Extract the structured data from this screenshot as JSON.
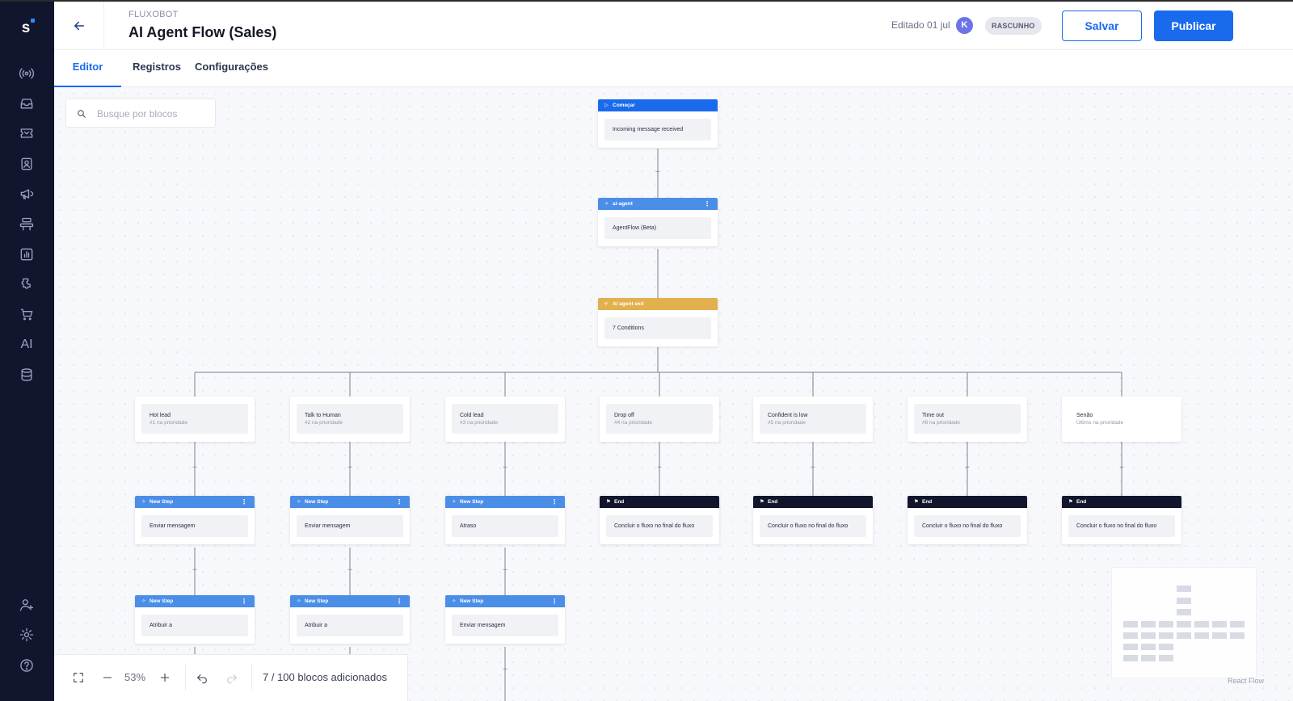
{
  "header": {
    "bot_label": "FLUXOBOT",
    "flow_title": "AI Agent Flow (Sales)",
    "edited": "Editado 01 jul",
    "avatar_initial": "K",
    "status_badge": "RASCUNHO",
    "save_label": "Salvar",
    "publish_label": "Publicar"
  },
  "tabs": [
    {
      "label": "Editor",
      "active": true
    },
    {
      "label": "Registros",
      "active": false
    },
    {
      "label": "Configurações",
      "active": false
    }
  ],
  "search": {
    "placeholder": "Busque por blocos"
  },
  "nodes": {
    "start": {
      "header": "Começar",
      "body": "Incoming message received"
    },
    "ai_agent": {
      "header": "ai-agent",
      "body": "AgentFlow (Beta)"
    },
    "agent_exit": {
      "header": "AI agent exit",
      "body": "7 Conditions"
    }
  },
  "conditions": [
    {
      "title": "Hot lead",
      "sub": "#1 na prioridade"
    },
    {
      "title": "Talk to Human",
      "sub": "#2 na prioridade"
    },
    {
      "title": "Cold lead",
      "sub": "#3 na prioridade"
    },
    {
      "title": "Drop off",
      "sub": "#4 na prioridade"
    },
    {
      "title": "Confident is low",
      "sub": "#5 na prioridade"
    },
    {
      "title": "Time out",
      "sub": "#6 na prioridade"
    },
    {
      "title": "Senão",
      "sub": "Último na prioridade"
    }
  ],
  "steps_row1": [
    {
      "header": "New Step",
      "body": "Enviar mensagem"
    },
    {
      "header": "New Step",
      "body": "Enviar mensagem"
    },
    {
      "header": "New Step",
      "body": "Atraso"
    },
    {
      "header": "End",
      "body": "Concluir o fluxo no final do fluxo"
    },
    {
      "header": "End",
      "body": "Concluir o fluxo no final do fluxo"
    },
    {
      "header": "End",
      "body": "Concluir o fluxo no final do fluxo"
    },
    {
      "header": "End",
      "body": "Concluir o fluxo no final do fluxo"
    }
  ],
  "steps_row2": [
    {
      "header": "New Step",
      "body": "Atribuir a"
    },
    {
      "header": "New Step",
      "body": "Atribuir a"
    },
    {
      "header": "New Step",
      "body": "Enviar mensagem"
    }
  ],
  "controls": {
    "zoom": "53%",
    "block_count": "7 / 100 blocos adicionados"
  },
  "watermark": "React Flow",
  "colors": {
    "sidebar_bg": "#11162e",
    "accent": "#1a6aee",
    "step_header": "#4a8ee8",
    "exit_header": "#e2b04c",
    "end_header": "#12162c"
  },
  "sidebar_icons": [
    "broadcast-icon",
    "inbox-icon",
    "ticket-icon",
    "contacts-icon",
    "megaphone-icon",
    "flow-icon",
    "reports-icon",
    "integrations-icon",
    "cart-icon",
    "ai-icon",
    "database-icon",
    "add-user-icon",
    "settings-icon",
    "help-icon"
  ]
}
